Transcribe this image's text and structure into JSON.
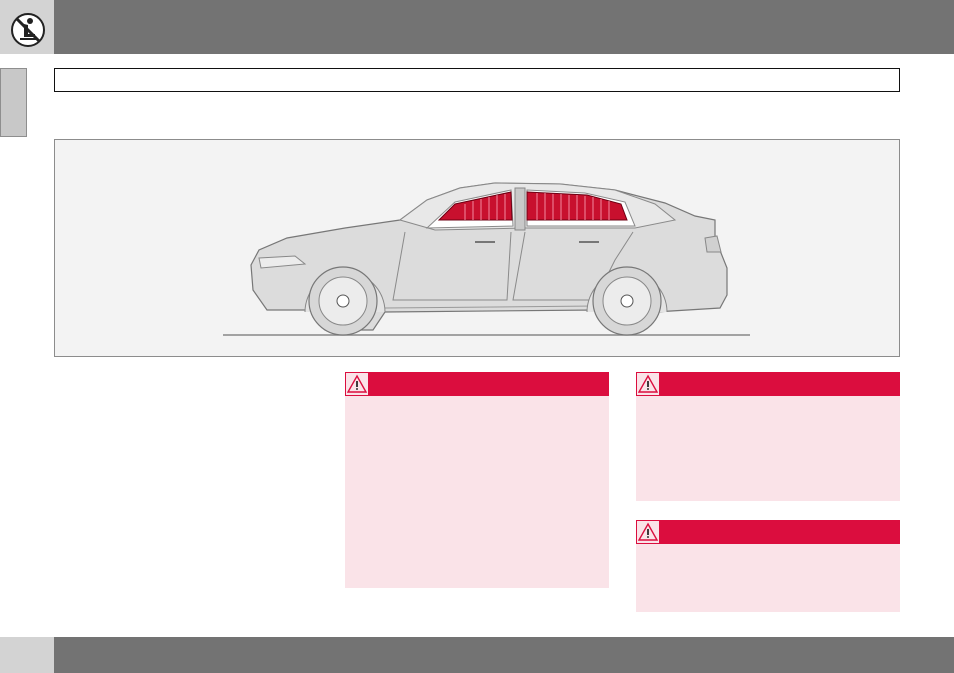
{
  "header": {
    "section_icon": "child-seat-prohibited-icon",
    "title": ""
  },
  "section_title": "",
  "figure": {
    "image": "car-side-view-inflatable-curtain-illustration",
    "colors": {
      "curtain": "#c8102e",
      "car_body": "#dcdcdc",
      "background": "#f3f3f3"
    }
  },
  "body_text": "",
  "warnings": [
    {
      "icon": "warning-triangle-icon",
      "label": "",
      "text": ""
    },
    {
      "icon": "warning-triangle-icon",
      "label": "",
      "text": ""
    },
    {
      "icon": "warning-triangle-icon",
      "label": "",
      "text": ""
    }
  ],
  "footer": {
    "page_number": ""
  },
  "colors": {
    "bar": "#737373",
    "tab": "#d3d3d3",
    "warning_red": "#db0d3e",
    "warning_bg": "#fae3e8"
  }
}
